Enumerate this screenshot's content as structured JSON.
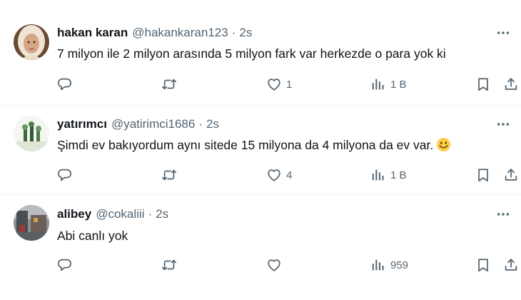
{
  "tweets": [
    {
      "name": "hakan karan",
      "handle": "@hakankaran123",
      "sep": "·",
      "time": "2s",
      "text": "7 milyon ile 2 milyon arasında 5 milyon fark var herkezde o para yok ki",
      "emoji": "",
      "reply_count": "",
      "retweet_count": "",
      "like_count": "1",
      "view_count": "1 B"
    },
    {
      "name": "yatırımcı",
      "handle": "@yatirimci1686",
      "sep": "·",
      "time": "2s",
      "text": "Şimdi ev bakıyordum aynı sitede 15 milyona da 4 milyona da ev var.",
      "emoji": "smiling-face-emoji",
      "reply_count": "",
      "retweet_count": "",
      "like_count": "4",
      "view_count": "1 B"
    },
    {
      "name": "alibey",
      "handle": "@cokaliii",
      "sep": "·",
      "time": "2s",
      "text": "Abi canlı yok",
      "emoji": "",
      "reply_count": "",
      "retweet_count": "",
      "like_count": "",
      "view_count": "959"
    }
  ],
  "icons": {
    "reply": "reply-icon",
    "retweet": "retweet-icon",
    "like": "like-icon",
    "views": "views-icon",
    "bookmark": "bookmark-icon",
    "share": "share-icon",
    "more": "more-icon"
  },
  "colors": {
    "text": "#0f1419",
    "secondary": "#536471",
    "divider": "#eff3f4"
  }
}
